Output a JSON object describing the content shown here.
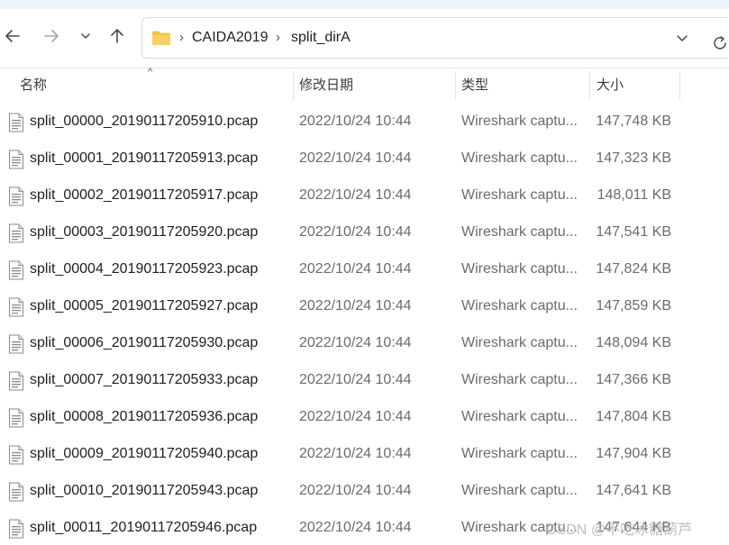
{
  "breadcrumb": [
    "CAIDA2019",
    "split_dirA"
  ],
  "columns": {
    "name": "名称",
    "date": "修改日期",
    "type": "类型",
    "size": "大小"
  },
  "files": [
    {
      "name": "split_00000_20190117205910.pcap",
      "date": "2022/10/24 10:44",
      "type": "Wireshark captu...",
      "size": "147,748 KB"
    },
    {
      "name": "split_00001_20190117205913.pcap",
      "date": "2022/10/24 10:44",
      "type": "Wireshark captu...",
      "size": "147,323 KB"
    },
    {
      "name": "split_00002_20190117205917.pcap",
      "date": "2022/10/24 10:44",
      "type": "Wireshark captu...",
      "size": "148,011 KB"
    },
    {
      "name": "split_00003_20190117205920.pcap",
      "date": "2022/10/24 10:44",
      "type": "Wireshark captu...",
      "size": "147,541 KB"
    },
    {
      "name": "split_00004_20190117205923.pcap",
      "date": "2022/10/24 10:44",
      "type": "Wireshark captu...",
      "size": "147,824 KB"
    },
    {
      "name": "split_00005_20190117205927.pcap",
      "date": "2022/10/24 10:44",
      "type": "Wireshark captu...",
      "size": "147,859 KB"
    },
    {
      "name": "split_00006_20190117205930.pcap",
      "date": "2022/10/24 10:44",
      "type": "Wireshark captu...",
      "size": "148,094 KB"
    },
    {
      "name": "split_00007_20190117205933.pcap",
      "date": "2022/10/24 10:44",
      "type": "Wireshark captu...",
      "size": "147,366 KB"
    },
    {
      "name": "split_00008_20190117205936.pcap",
      "date": "2022/10/24 10:44",
      "type": "Wireshark captu...",
      "size": "147,804 KB"
    },
    {
      "name": "split_00009_20190117205940.pcap",
      "date": "2022/10/24 10:44",
      "type": "Wireshark captu...",
      "size": "147,904 KB"
    },
    {
      "name": "split_00010_20190117205943.pcap",
      "date": "2022/10/24 10:44",
      "type": "Wireshark captu...",
      "size": "147,641 KB"
    },
    {
      "name": "split_00011_20190117205946.pcap",
      "date": "2022/10/24 10:44",
      "type": "Wireshark captu...",
      "size": "147,644 KB"
    }
  ],
  "watermark": "CSDN @不吃冰糖葫芦",
  "colors": {
    "folder": "#f4c343",
    "icon_gray": "#8a8a8a",
    "text": "#1f1f1f",
    "muted_text": "#6b6b6b"
  },
  "icons": {
    "back": "arrow-left-icon",
    "forward": "arrow-right-icon",
    "recent": "chevron-down-icon",
    "up": "arrow-up-icon",
    "folder": "folder-icon",
    "refresh": "refresh-icon",
    "file": "pcap-file-icon"
  }
}
